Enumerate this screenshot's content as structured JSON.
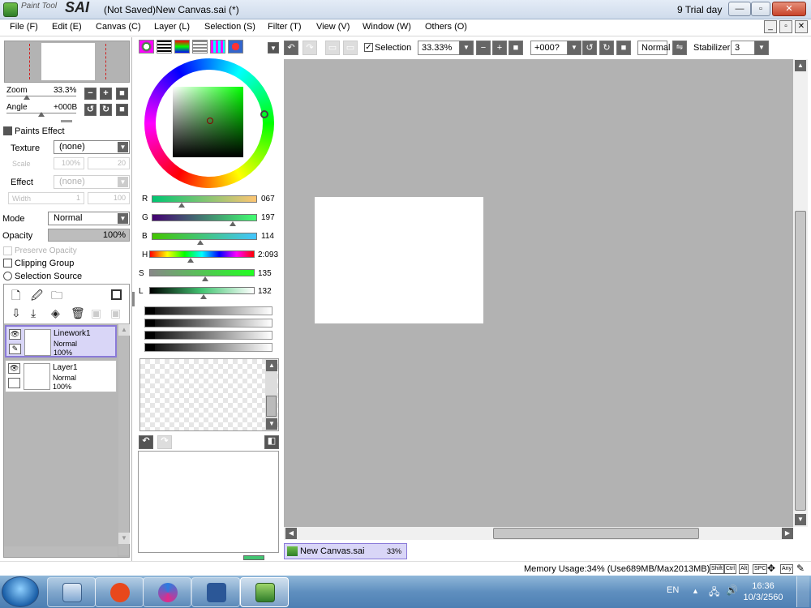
{
  "window": {
    "logo_small": "Paint Tool",
    "logo_big": "SAI",
    "title": "(Not Saved)New Canvas.sai (*)",
    "trial": "9 Trial day",
    "minimize": "—",
    "restore": "▫",
    "close": "✕"
  },
  "menu": [
    "File (F)",
    "Edit (E)",
    "Canvas (C)",
    "Layer (L)",
    "Selection (S)",
    "Filter (T)",
    "View (V)",
    "Window (W)",
    "Others (O)"
  ],
  "navigator": {
    "zoom_label": "Zoom",
    "zoom_value": "33.3%",
    "angle_label": "Angle",
    "angle_value": "+000B"
  },
  "paints_effect": {
    "header": "Paints Effect",
    "texture_label": "Texture",
    "texture_value": "(none)",
    "scale_label": "Scale",
    "scale_value": "100%",
    "scale_num": "20",
    "effect_label": "Effect",
    "effect_value": "(none)",
    "width_label": "Width",
    "width_value": "1",
    "width_num": "100"
  },
  "layer_props": {
    "mode_label": "Mode",
    "mode_value": "Normal",
    "opacity_label": "Opacity",
    "opacity_value": "100%",
    "preserve": "Preserve Opacity",
    "clipping": "Clipping Group",
    "selection_source": "Selection Source"
  },
  "layers": [
    {
      "name": "Linework1",
      "mode": "Normal",
      "opacity": "100%"
    },
    {
      "name": "Layer1",
      "mode": "Normal",
      "opacity": "100%"
    }
  ],
  "color": {
    "r_label": "R",
    "r": "067",
    "g_label": "G",
    "g": "197",
    "b_label": "B",
    "b": "114",
    "h_label": "H",
    "h": "2:093",
    "s_label": "S",
    "s": "135",
    "l_label": "L",
    "l": "132"
  },
  "toolbar": {
    "selection_label": "Selection",
    "zoom": "33.33%",
    "angle": "+000?",
    "blend": "Normal",
    "stabilizer_label": "Stabilizer",
    "stabilizer": "3"
  },
  "doc_tab": {
    "name": "New Canvas.sai",
    "zoom": "33%"
  },
  "status": {
    "memory": "Memory Usage:34% (Use689MB/Max2013MB)",
    "keys": [
      "Shift",
      "Ctrl",
      "Alt",
      "SPC",
      "Any"
    ]
  },
  "taskbar": {
    "lang": "EN",
    "time": "16:36",
    "date": "10/3/2560"
  },
  "colors": {
    "accent": "#8a7ad8",
    "selected_bg": "#d9d6f7",
    "canvas_bg": "#b2b2b2"
  }
}
